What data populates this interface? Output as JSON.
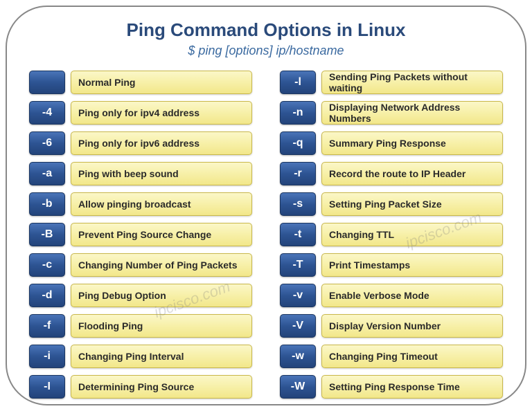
{
  "title": "Ping Command Options in Linux",
  "subtitle": "$ ping [options] ip/hostname",
  "watermark": "ipcisco.com",
  "left": [
    {
      "flag": "",
      "desc": "Normal Ping"
    },
    {
      "flag": "-4",
      "desc": "Ping only for ipv4 address"
    },
    {
      "flag": "-6",
      "desc": "Ping only for ipv6 address"
    },
    {
      "flag": "-a",
      "desc": "Ping with beep sound"
    },
    {
      "flag": "-b",
      "desc": "Allow  pinging broadcast"
    },
    {
      "flag": "-B",
      "desc": "Prevent Ping Source Change"
    },
    {
      "flag": "-c",
      "desc": "Changing Number of Ping Packets"
    },
    {
      "flag": "-d",
      "desc": "Ping Debug Option"
    },
    {
      "flag": "-f",
      "desc": "Flooding Ping"
    },
    {
      "flag": "-i",
      "desc": "Changing Ping Interval"
    },
    {
      "flag": "-I",
      "desc": "Determining Ping Source"
    }
  ],
  "right": [
    {
      "flag": "-l",
      "desc": "Sending Ping Packets without waiting"
    },
    {
      "flag": "-n",
      "desc": "Displaying Network Address Numbers"
    },
    {
      "flag": "-q",
      "desc": "Summary Ping Response"
    },
    {
      "flag": "-r",
      "desc": "Record the route to IP Header"
    },
    {
      "flag": "-s",
      "desc": "Setting Ping Packet Size"
    },
    {
      "flag": "-t",
      "desc": "Changing TTL"
    },
    {
      "flag": "-T",
      "desc": "Print Timestamps"
    },
    {
      "flag": "-v",
      "desc": "Enable Verbose Mode"
    },
    {
      "flag": "-V",
      "desc": "Display Version Number"
    },
    {
      "flag": "-w",
      "desc": "Changing Ping Timeout"
    },
    {
      "flag": "-W",
      "desc": "Setting Ping Response Time"
    }
  ]
}
